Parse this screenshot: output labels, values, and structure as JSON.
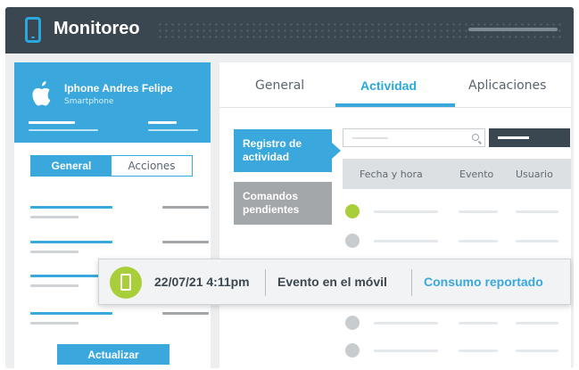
{
  "app": {
    "title": "Monitoreo"
  },
  "device": {
    "name": "Iphone Andres Felipe",
    "type": "Smartphone"
  },
  "left_tabs": [
    {
      "label": "General",
      "active": true
    },
    {
      "label": "Acciones",
      "active": false
    }
  ],
  "left_panel": {
    "refresh_label": "Actualizar"
  },
  "top_tabs": [
    {
      "label": "General",
      "active": false
    },
    {
      "label": "Actividad",
      "active": true
    },
    {
      "label": "Aplicaciones",
      "active": false
    }
  ],
  "side_menu": [
    {
      "label": "Registro de actividad",
      "active": true
    },
    {
      "label": "Comandos pendientes",
      "active": false
    }
  ],
  "table": {
    "columns": [
      "Fecha y hora",
      "Evento",
      "Usuario"
    ]
  },
  "notification": {
    "datetime": "22/07/21 4:11pm",
    "event": "Evento en el móvil",
    "status": "Consumo reportado"
  },
  "colors": {
    "header": "#3a4750",
    "accent": "#3aa8dc",
    "success": "#a8cf3a",
    "inactive": "#a3a7aa"
  },
  "icons": [
    "phone-icon",
    "apple-icon",
    "search-icon",
    "notification-phone-icon"
  ]
}
